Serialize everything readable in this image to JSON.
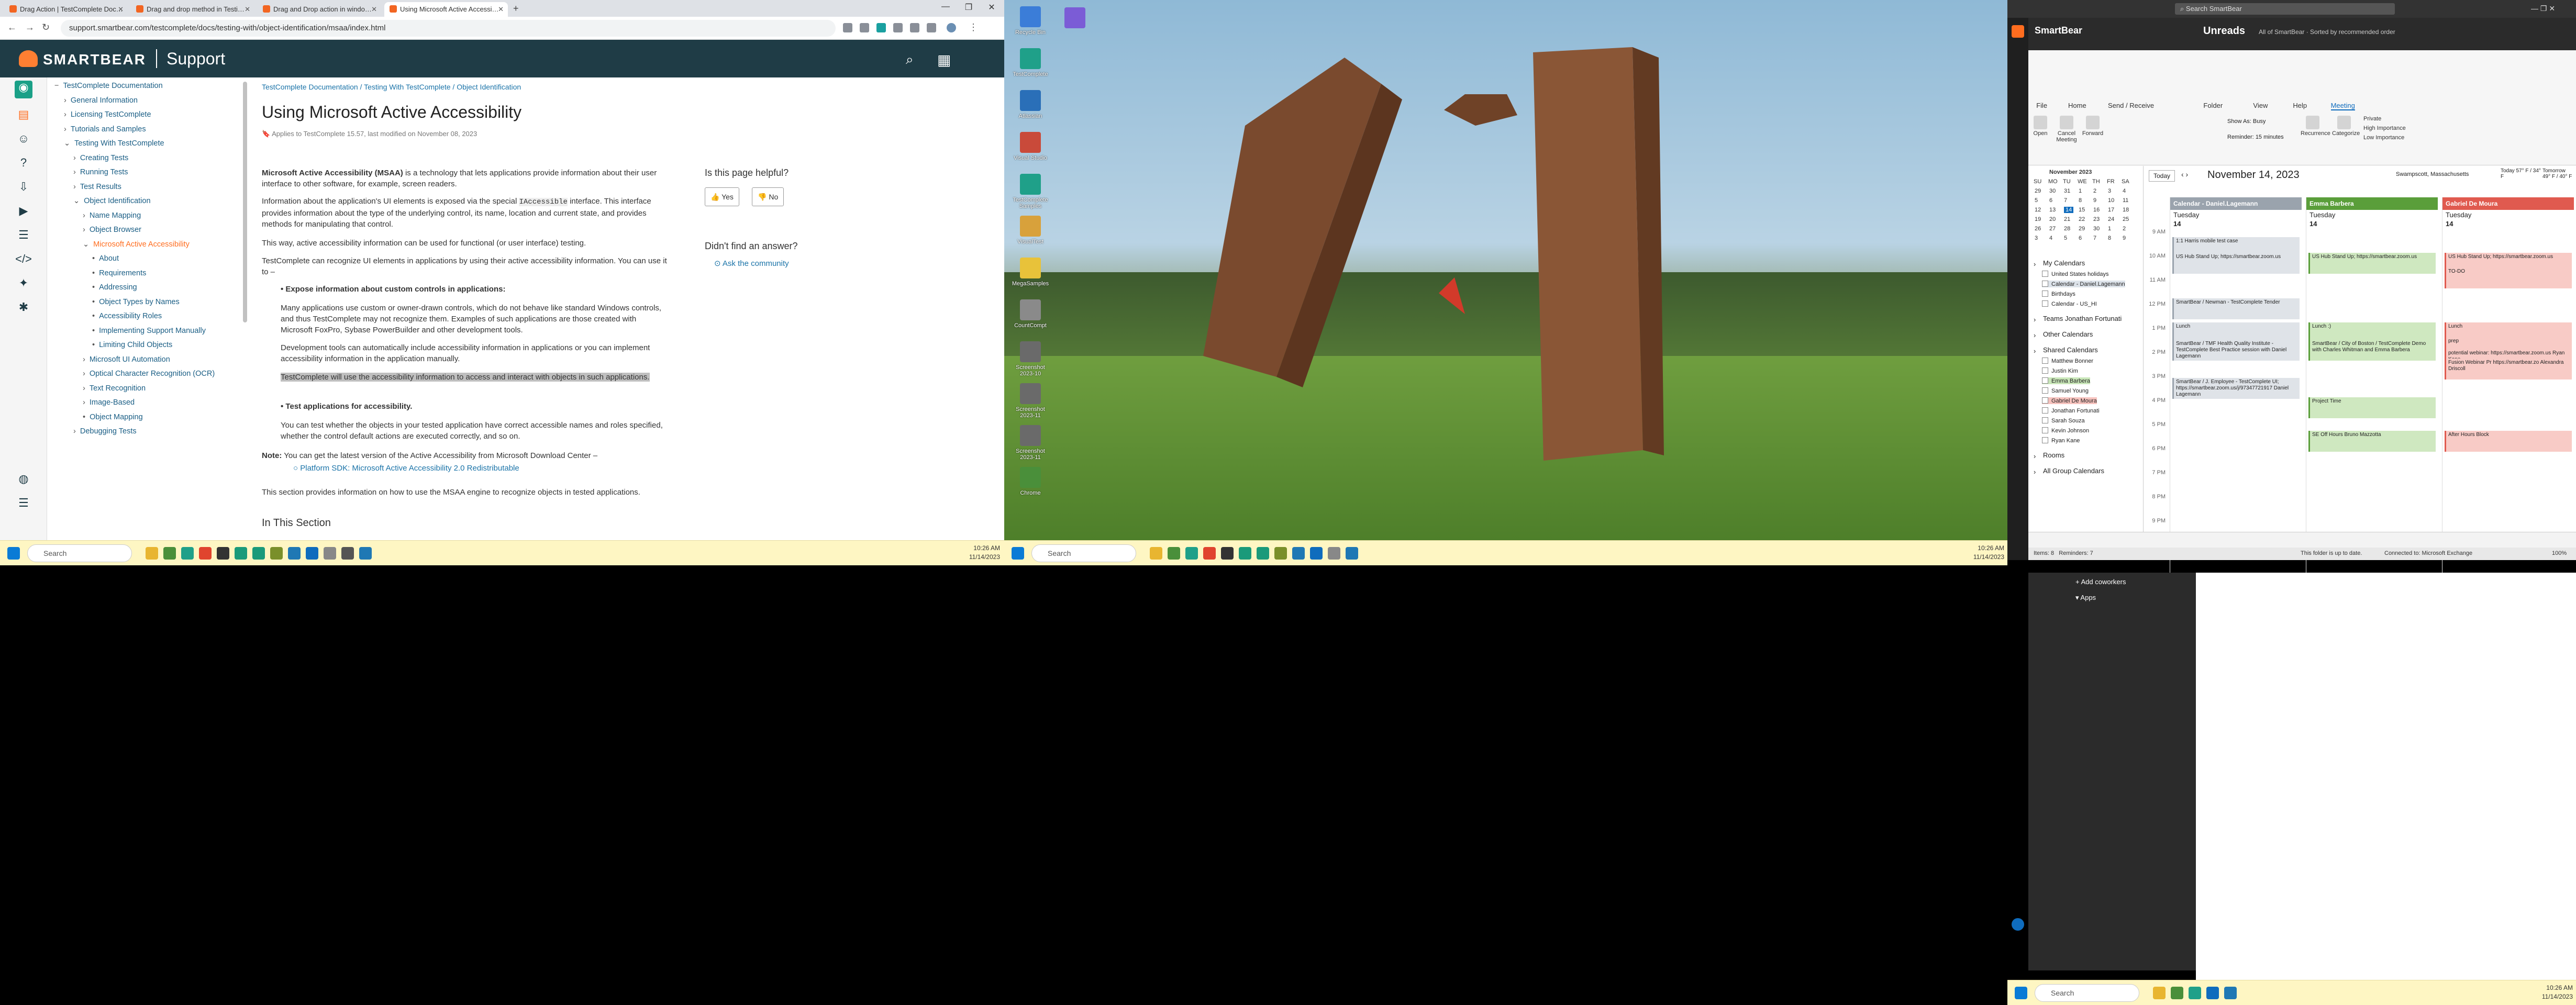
{
  "screen1": {
    "tabs": [
      {
        "title": "Drag Action | TestComplete Doc…"
      },
      {
        "title": "Drag and drop method in Testi…"
      },
      {
        "title": "Drag and Drop action in windo…"
      },
      {
        "title": "Using Microsoft Active Accessi…"
      }
    ],
    "url": "support.smartbear.com/testcomplete/docs/testing-with/object-identification/msaa/index.html",
    "brand": "SMARTBEAR",
    "support_label": "Support",
    "toc": [
      {
        "label": "TestComplete Documentation",
        "indent": 0,
        "prefix": "−"
      },
      {
        "label": "General Information",
        "indent": 1,
        "prefix": "›"
      },
      {
        "label": "Licensing TestComplete",
        "indent": 1,
        "prefix": "›"
      },
      {
        "label": "Tutorials and Samples",
        "indent": 1,
        "prefix": "›"
      },
      {
        "label": "Testing With TestComplete",
        "indent": 1,
        "prefix": "⌄"
      },
      {
        "label": "Creating Tests",
        "indent": 2,
        "prefix": "›"
      },
      {
        "label": "Running Tests",
        "indent": 2,
        "prefix": "›"
      },
      {
        "label": "Test Results",
        "indent": 2,
        "prefix": "›"
      },
      {
        "label": "Object Identification",
        "indent": 2,
        "prefix": "⌄"
      },
      {
        "label": "Name Mapping",
        "indent": 3,
        "prefix": "›"
      },
      {
        "label": "Object Browser",
        "indent": 3,
        "prefix": "›"
      },
      {
        "label": "Microsoft Active Accessibility",
        "indent": 3,
        "prefix": "⌄",
        "current": true
      },
      {
        "label": "About",
        "indent": 4,
        "prefix": "•"
      },
      {
        "label": "Requirements",
        "indent": 4,
        "prefix": "•"
      },
      {
        "label": "Addressing",
        "indent": 4,
        "prefix": "•"
      },
      {
        "label": "Object Types by Names",
        "indent": 4,
        "prefix": "•"
      },
      {
        "label": "Accessibility Roles",
        "indent": 4,
        "prefix": "•"
      },
      {
        "label": "Implementing Support Manually",
        "indent": 4,
        "prefix": "•"
      },
      {
        "label": "Limiting Child Objects",
        "indent": 4,
        "prefix": "•"
      },
      {
        "label": "Microsoft UI Automation",
        "indent": 3,
        "prefix": "›"
      },
      {
        "label": "Optical Character Recognition (OCR)",
        "indent": 3,
        "prefix": "›"
      },
      {
        "label": "Text Recognition",
        "indent": 3,
        "prefix": "›"
      },
      {
        "label": "Image-Based",
        "indent": 3,
        "prefix": "›"
      },
      {
        "label": "Object Mapping",
        "indent": 3,
        "prefix": "•"
      },
      {
        "label": "Debugging Tests",
        "indent": 2,
        "prefix": "›"
      }
    ],
    "breadcrumb": "TestComplete Documentation / Testing With TestComplete / Object Identification",
    "title": "Using Microsoft Active Accessibility",
    "meta": "Applies to TestComplete 15.57, last modified on November 08, 2023",
    "para1_bold": "Microsoft Active Accessibility (MSAA)",
    "para1": " is a technology that lets applications provide information about their user interface to other software, for example, screen readers.",
    "para2a": "Information about the application's UI elements is exposed via the special ",
    "para2_code": "IAccessible",
    "para2b": " interface. This interface provides information about the type of the underlying control, its name, location and current state, and provides methods for manipulating that control.",
    "para3": "This way, active accessibility information can be used for functional (or user interface) testing.",
    "para4": "TestComplete can recognize UI elements in applications by using their active accessibility information. You can use it to –",
    "bullet1_title": "Expose information about custom controls in applications",
    "bullet1_p1": "Many applications use custom or owner-drawn controls, which do not behave like standard Windows controls, and thus TestComplete may not recognize them. Examples of such applications are those created with Microsoft FoxPro, Sybase PowerBuilder and other development tools.",
    "bullet1_p2": "Development tools can automatically include accessibility information in applications or you can implement accessibility information in the application manually.",
    "bullet1_p3": "TestComplete will use the accessibility information to access and interact with objects in such applications.",
    "bullet2_title": "Test applications for accessibility",
    "bullet2_p1": "You can test whether the objects in your tested application have correct accessible names and roles specified, whether the control default actions are executed correctly, and so on.",
    "note_label": "Note:",
    "note_text": "You can get the latest version of the Active Accessibility from Microsoft Download Center –",
    "note_link": "Platform SDK: Microsoft Active Accessibility 2.0 Redistributable",
    "para5": "This section provides information on how to use the MSAA engine to recognize objects in tested applications.",
    "in_section": "In This Section",
    "helpful_q": "Is this page helpful?",
    "yes": "Yes",
    "no": "No",
    "didnt_find": "Didn't find an answer?",
    "ask_community": "Ask the community",
    "taskbar_search": "Search",
    "time": "10:26 AM",
    "date": "11/14/2023"
  },
  "screen2": {
    "desktop_icons": [
      "Recycle Bin",
      "TestComplete",
      "Atlassian",
      "Visual Studio",
      "TestComplete Samples",
      "VisualTest",
      "MegaSamples",
      "CountCompt",
      "Screenshot 2023-10",
      "Screenshot 2023-11",
      "Screenshot 2023-11",
      "Chrome"
    ],
    "taskbar_search": "Search",
    "time": "10:26 AM",
    "date": "11/14/2023"
  },
  "screen3": {
    "search_placeholder": "Search SmartBear",
    "account": "SmartBear",
    "inbox_title": "Unreads",
    "inbox_sub": "All of SmartBear · Sorted by recommended order",
    "ribbon_tabs": [
      "File",
      "Home",
      "Send / Receive",
      "Folder",
      "View",
      "Help",
      "Meeting"
    ],
    "ribbon_buttons": [
      "Open",
      "Cancel Meeting",
      "Forward",
      "Show As:",
      "Reminder:",
      "Recurrence",
      "Categorize",
      "Private",
      "High Importance",
      "Low Importance"
    ],
    "show_as_value": "Busy",
    "reminder_value": "15 minutes",
    "month_label": "November 2023",
    "today_btn": "Today",
    "date_title": "November 14, 2023",
    "location": "Swampscott, Massachusetts",
    "weather_today": "Today 57° F / 34° F",
    "weather_tomorrow": "Tomorrow 49° F / 40° F",
    "weekdays": [
      "SU",
      "MO",
      "TU",
      "WE",
      "TH",
      "FR",
      "SA"
    ],
    "month_rows": [
      [
        "29",
        "30",
        "31",
        "1",
        "2",
        "3",
        "4"
      ],
      [
        "5",
        "6",
        "7",
        "8",
        "9",
        "10",
        "11"
      ],
      [
        "12",
        "13",
        "14",
        "15",
        "16",
        "17",
        "18"
      ],
      [
        "19",
        "20",
        "21",
        "22",
        "23",
        "24",
        "25"
      ],
      [
        "26",
        "27",
        "28",
        "29",
        "30",
        "1",
        "2"
      ],
      [
        "3",
        "4",
        "5",
        "6",
        "7",
        "8",
        "9"
      ]
    ],
    "folders": [
      {
        "label": "My Calendars",
        "type": "header"
      },
      {
        "label": "United States holidays",
        "type": "check"
      },
      {
        "label": "Calendar - Daniel.Lagemann",
        "type": "check"
      },
      {
        "label": "Birthdays",
        "type": "check"
      },
      {
        "label": "Calendar - US_HI",
        "type": "check"
      },
      {
        "label": "Teams Jonathan Fortunati",
        "type": "header"
      },
      {
        "label": "Other Calendars",
        "type": "header"
      },
      {
        "label": "Shared Calendars",
        "type": "header"
      },
      {
        "label": "Matthew Bonner",
        "type": "check"
      },
      {
        "label": "Justin Kim",
        "type": "check"
      },
      {
        "label": "Emma Barbera",
        "type": "check"
      },
      {
        "label": "Samuel Young",
        "type": "check"
      },
      {
        "label": "Gabriel De Moura",
        "type": "check"
      },
      {
        "label": "Jonathan Fortunati",
        "type": "check"
      },
      {
        "label": "Sarah Souza",
        "type": "check"
      },
      {
        "label": "Kevin Johnson",
        "type": "check"
      },
      {
        "label": "Ryan Kane",
        "type": "check"
      },
      {
        "label": "Rooms",
        "type": "header"
      },
      {
        "label": "All Group Calendars",
        "type": "header"
      }
    ],
    "hours": [
      "9 AM",
      "10 AM",
      "11 AM",
      "12 PM",
      "1 PM",
      "2 PM",
      "3 PM",
      "4 PM",
      "5 PM",
      "6 PM",
      "7 PM",
      "8 PM",
      "9 PM"
    ],
    "calendars": [
      {
        "name": "Calendar - Daniel.Lagemann",
        "day": "Tuesday",
        "date": "14",
        "color": "#9aa3ad",
        "events": [
          {
            "text": "1:1 Harris mobile test case",
            "slot": 0.35
          },
          {
            "text": "US Hub Stand Up; https://smartbear.zoom.us",
            "slot": 1.0
          },
          {
            "text": "SmartBear / Newman - TestComplete Tender",
            "slot": 2.9
          },
          {
            "text": "Lunch",
            "slot": 3.9
          },
          {
            "text": "SmartBear / TMF Health Quality Institute - TestComplete Best Practice session with Daniel Lagemann",
            "slot": 4.6
          },
          {
            "text": "SmartBear / J. Employee - TestComplete UI; https://smartbear.zoom.us/j/97347721917 Daniel Lagemann",
            "slot": 6.2
          }
        ]
      },
      {
        "name": "Emma Barbera",
        "day": "Tuesday",
        "date": "14",
        "color": "#5a9e3a",
        "events": [
          {
            "text": "US Hub Stand Up; https://smartbear.zoom.us",
            "slot": 1.0
          },
          {
            "text": "Lunch :)",
            "slot": 3.9
          },
          {
            "text": "SmartBear / City of Boston / TestComplete Demo with Charles Whitman and Emma Barbera",
            "slot": 4.6
          },
          {
            "text": "Project Time",
            "slot": 7.0
          },
          {
            "text": "SE Off Hours Bruno Mazzotta",
            "slot": 8.4
          }
        ]
      },
      {
        "name": "Gabriel De Moura",
        "day": "Tuesday",
        "date": "14",
        "color": "#e05a4f",
        "events": [
          {
            "text": "US Hub Stand Up; https://smartbear.zoom.us",
            "slot": 1.0
          },
          {
            "text": "TO-DO",
            "slot": 1.6
          },
          {
            "text": "Lunch",
            "slot": 3.9
          },
          {
            "text": "prep",
            "slot": 4.5
          },
          {
            "text": "potential webinar: https://smartbear.zoom.us Ryan Kane",
            "slot": 5.0
          },
          {
            "text": "Fusion Webinar Pr https://smartbear.zo Alexandra Driscoll",
            "slot": 5.4
          },
          {
            "text": "After Hours Block",
            "slot": 8.4
          }
        ]
      }
    ],
    "status_items": "Items: 8",
    "status_reminders": "Reminders: 7",
    "status_sync": "This folder is up to date.",
    "status_conn": "Connected to: Microsoft Exchange",
    "zoom": "100%",
    "extra_links": [
      "Add coworkers",
      "Apps"
    ],
    "time": "10:26 AM",
    "date": "11/14/2023",
    "taskbar_search": "Search"
  }
}
